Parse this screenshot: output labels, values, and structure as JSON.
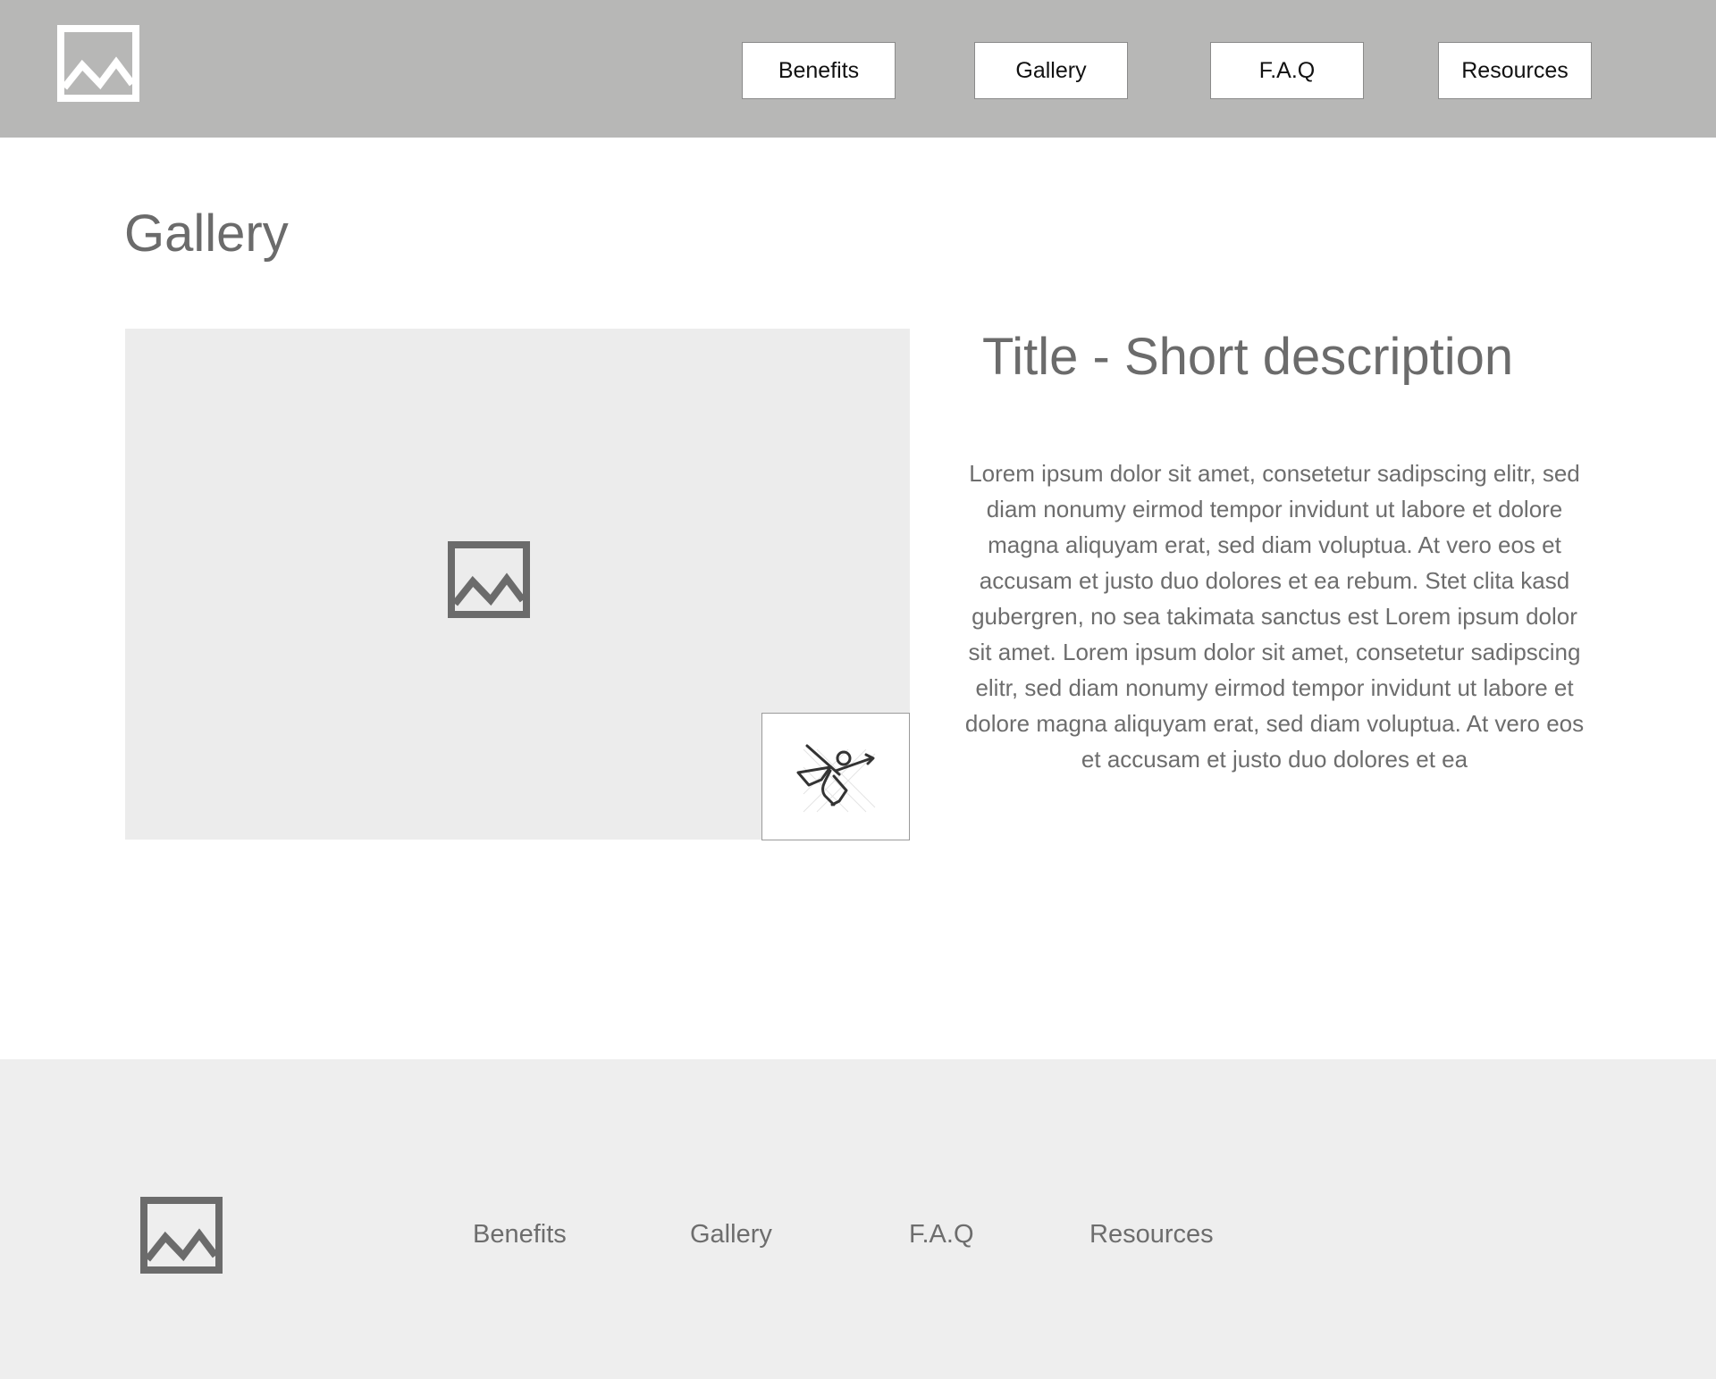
{
  "header": {
    "logo_icon": "image-placeholder-icon",
    "nav": [
      {
        "label": "Benefits"
      },
      {
        "label": "Gallery"
      },
      {
        "label": "F.A.Q"
      },
      {
        "label": "Resources"
      }
    ]
  },
  "main": {
    "page_title": "Gallery",
    "image_icon": "image-placeholder-icon",
    "thumbnail_icon": "flying-superhero-icon",
    "card_title": "Title - Short description",
    "card_body": "Lorem ipsum dolor sit amet, consetetur sadipscing elitr, sed diam nonumy eirmod tempor invidunt ut labore et dolore magna aliquyam erat, sed diam voluptua. At vero eos et accusam et justo duo dolores et ea rebum. Stet clita kasd gubergren, no sea takimata sanctus est Lorem ipsum dolor sit amet. Lorem ipsum dolor sit amet, consetetur sadipscing elitr, sed diam nonumy eirmod tempor invidunt ut labore et dolore magna aliquyam erat, sed diam voluptua. At vero eos et accusam et justo duo dolores et ea"
  },
  "footer": {
    "logo_icon": "image-placeholder-icon",
    "links": [
      {
        "label": "Benefits"
      },
      {
        "label": "Gallery"
      },
      {
        "label": "F.A.Q"
      },
      {
        "label": "Resources"
      }
    ]
  },
  "colors": {
    "header_bg": "#b7b7b6",
    "image_panel_bg": "#ececec",
    "footer_bg": "#eeeeee",
    "text_gray": "#6b6b6b"
  }
}
